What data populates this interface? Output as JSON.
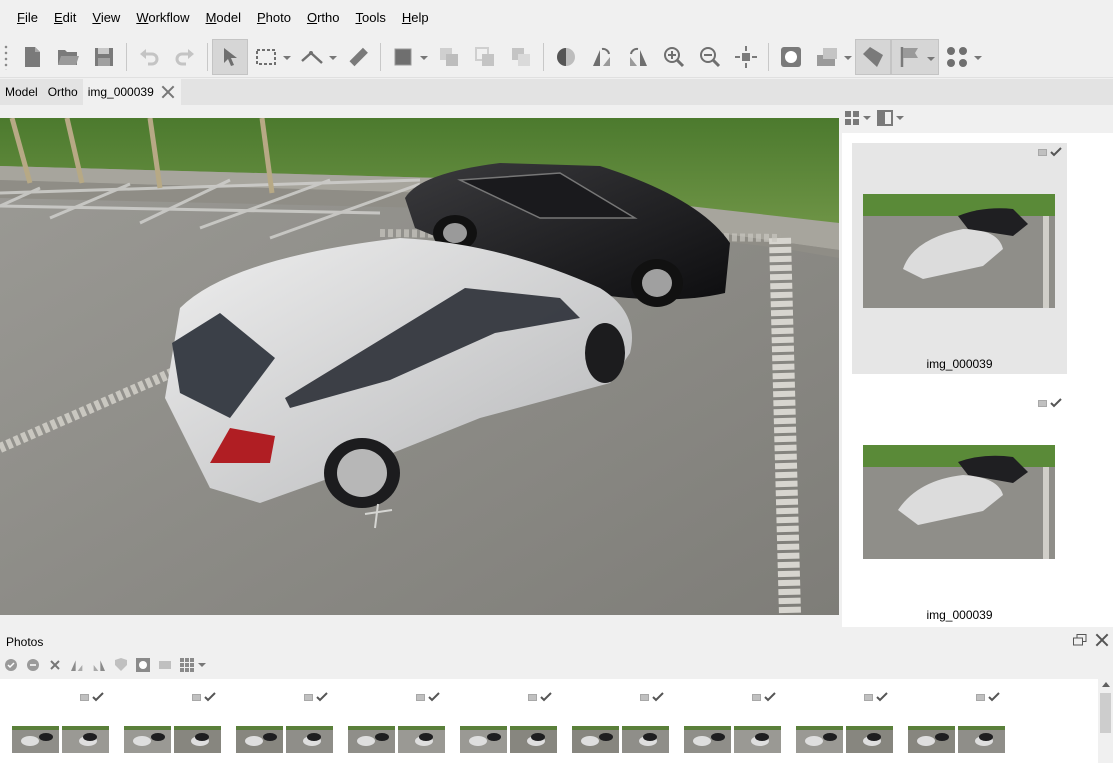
{
  "menu": [
    "File",
    "Edit",
    "View",
    "Workflow",
    "Model",
    "Photo",
    "Ortho",
    "Tools",
    "Help"
  ],
  "tabs": [
    "Model",
    "Ortho",
    "img_000039"
  ],
  "side_panel": {
    "thumbnails": [
      {
        "label": "img_000039",
        "selected": true
      },
      {
        "label": "img_000039",
        "selected": false
      }
    ]
  },
  "photos_panel": {
    "title": "Photos",
    "strip_count": 9
  },
  "colors": {
    "chrome": "#f0f0f0",
    "tab_bar": "#e3e3e3",
    "selected_card": "#e6e6e6"
  }
}
